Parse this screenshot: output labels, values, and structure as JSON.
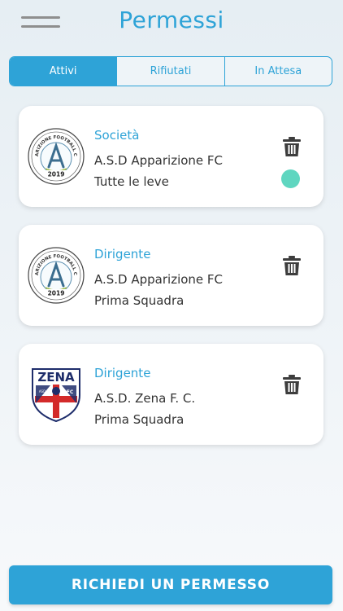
{
  "header": {
    "title": "Permessi",
    "menu_icon": "hamburger-menu-icon"
  },
  "tabs": [
    {
      "label": "Attivi",
      "active": true
    },
    {
      "label": "Rifiutati",
      "active": false
    },
    {
      "label": "In Attesa",
      "active": false
    }
  ],
  "permissions": [
    {
      "role": "Società",
      "club": "A.S.D Apparizione FC",
      "team": "Tutte le leve",
      "logo": "apparizione-logo",
      "status_dot": true
    },
    {
      "role": "Dirigente",
      "club": "A.S.D Apparizione FC",
      "team": "Prima Squadra",
      "logo": "apparizione-logo",
      "status_dot": false
    },
    {
      "role": "Dirigente",
      "club": "A.S.D. Zena F. C.",
      "team": "Prima Squadra",
      "logo": "zena-logo",
      "status_dot": false
    }
  ],
  "logos": {
    "apparizione": {
      "name_text": "APPARIZIONE FOOTBALL CLUB",
      "year": "2019"
    },
    "zena": {
      "name_text": "ZENA",
      "abbr_left": "ASD",
      "abbr_right": "FC"
    }
  },
  "cta": {
    "label": "RICHIEDI UN PERMESSO"
  },
  "colors": {
    "accent": "#2ea3d7",
    "status_dot": "#5fd6c0",
    "card_bg": "#ffffff"
  }
}
